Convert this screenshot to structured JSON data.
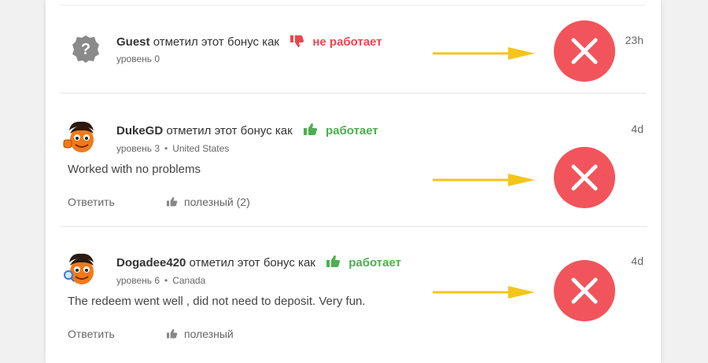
{
  "reviews": [
    {
      "username": "Guest",
      "action": "отметил этот бонус как",
      "status": "не работает",
      "status_type": "bad",
      "meta_level": "уровень 0",
      "time": "23h"
    },
    {
      "username": "DukeGD",
      "action": "отметил этот бонус как",
      "status": "работает",
      "status_type": "good",
      "meta_level": "уровень 3",
      "meta_country": "United States",
      "time": "4d",
      "comment": "Worked with no problems",
      "reply_label": "Ответить",
      "helpful_label": "полезный (2)"
    },
    {
      "username": "Dogadee420",
      "action": "отметил этот бонус как",
      "status": "работает",
      "status_type": "good",
      "meta_level": "уровень 6",
      "meta_country": "Canada",
      "time": "4d",
      "comment": "The redeem went well , did not need to deposit. Very fun.",
      "reply_label": "Ответить",
      "helpful_label": "полезный"
    }
  ],
  "colors": {
    "bad": "#e8474f",
    "good": "#4caf50",
    "x_circle": "#f2545b",
    "arrow": "#f5c518"
  }
}
